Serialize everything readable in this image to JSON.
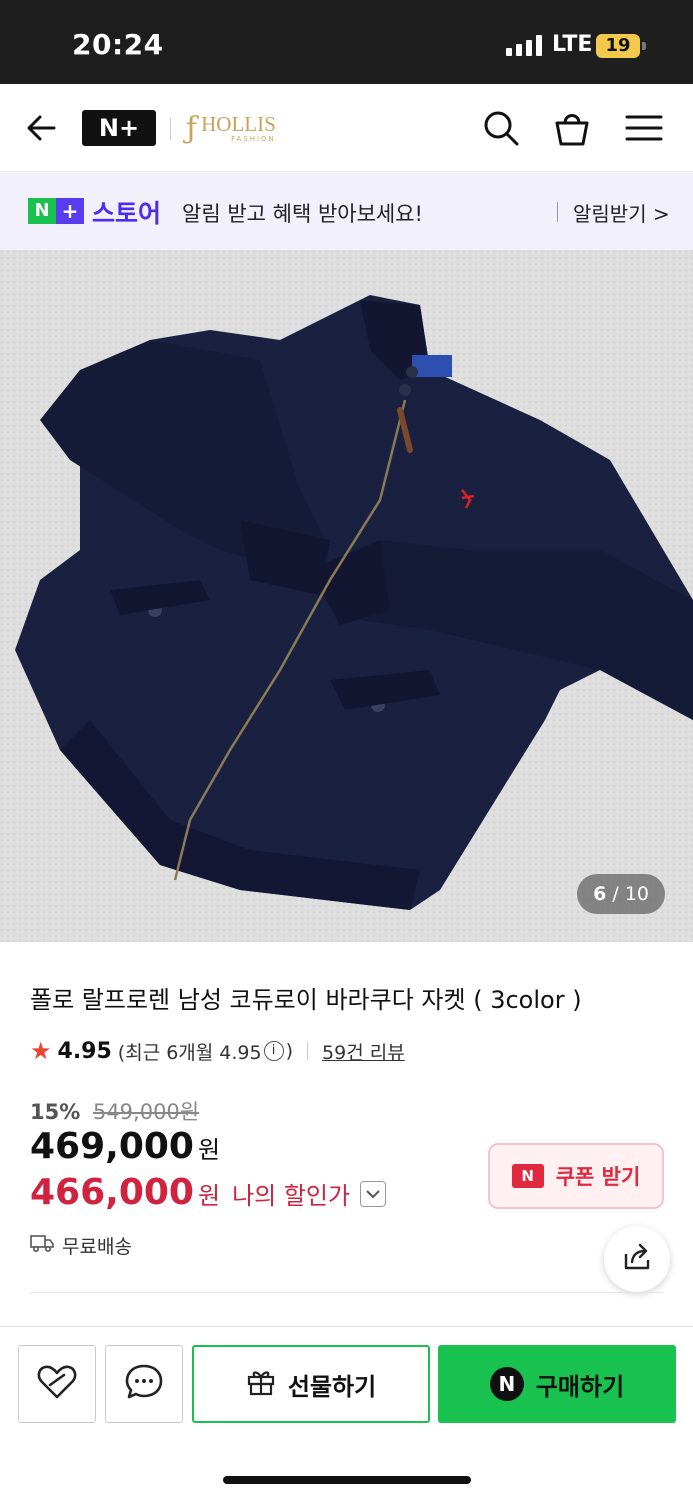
{
  "status_bar": {
    "time": "20:24",
    "network": "LTE",
    "battery": "19"
  },
  "header": {
    "store_logo": "N+",
    "brand_name": "HOLLIS",
    "brand_sub": "FASHION",
    "icons": [
      "back-arrow-icon",
      "search-icon",
      "shopping-bag-icon",
      "menu-icon"
    ]
  },
  "notice": {
    "badge_n": "N",
    "badge_plus": "+",
    "store": "스토어",
    "message": "알림 받고 혜택 받아보세요!",
    "action": "알림받기 >"
  },
  "gallery": {
    "current": "6",
    "total": "10",
    "separator": "/"
  },
  "product": {
    "title": "폴로 랄프로렌 남성 코듀로이 바라쿠다 자켓 ( 3color )",
    "rating_score": "4.95",
    "rating_recent_prefix": "(최근 6개월 4.95",
    "rating_recent_suffix": ")",
    "reviews": "59건 리뷰",
    "discount_rate": "15%",
    "original_price": "549,000원",
    "price": "469,000",
    "price_unit": "원",
    "my_price": "466,000",
    "my_price_unit": "원",
    "my_price_label": "나의 할인가",
    "shipping": "무료배송"
  },
  "coupon": {
    "icon_text": "N",
    "label": "쿠폰 받기"
  },
  "bottom_bar": {
    "gift_label": "선물하기",
    "buy_label": "구매하기",
    "buy_icon": "N"
  },
  "colors": {
    "naver_green": "#19c24f",
    "plus_purple": "#5a3cf0",
    "discount_red": "#d0233f",
    "coupon_red": "#e0283e",
    "rating_star": "#e8472e"
  }
}
